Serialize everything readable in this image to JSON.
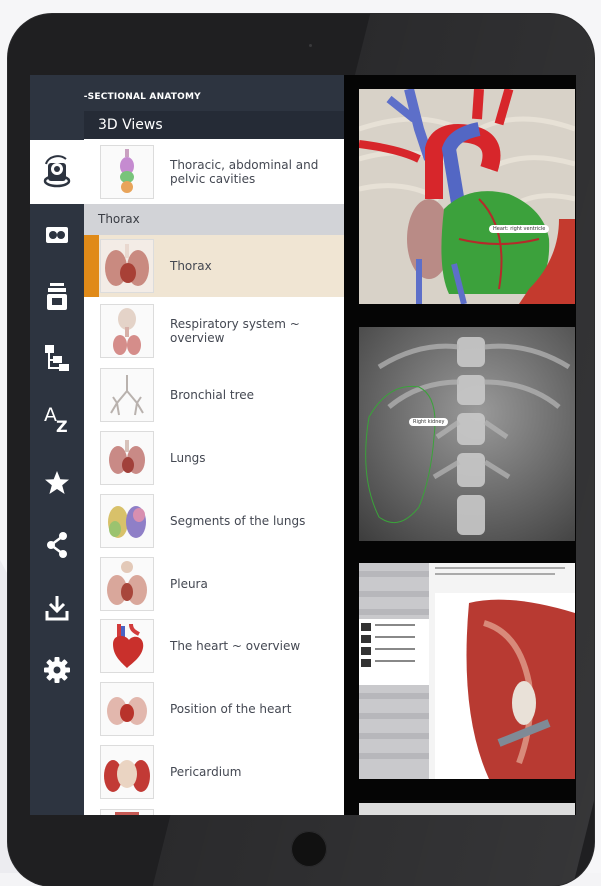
{
  "app": {
    "title": "CROSS-SECTIONAL ANATOMY"
  },
  "section": {
    "title": "3D Views"
  },
  "featured_item": {
    "label": "Thoracic, abdominal and pelvic cavities",
    "thumb_icon": "torso-organs-icon"
  },
  "category": {
    "title": "Thorax"
  },
  "rail_icons": [
    {
      "name": "3d-rotate-icon",
      "active": true
    },
    {
      "name": "cross-section-icon",
      "active": false
    },
    {
      "name": "layers-icon",
      "active": false
    },
    {
      "name": "hierarchy-icon",
      "active": false
    },
    {
      "name": "a-z-index-icon",
      "active": false
    },
    {
      "name": "star-icon",
      "active": false
    },
    {
      "name": "share-icon",
      "active": false
    },
    {
      "name": "download-icon",
      "active": false
    },
    {
      "name": "gear-icon",
      "active": false
    }
  ],
  "items": [
    {
      "label": "Thorax",
      "selected": true
    },
    {
      "label": "Respiratory system ~ overview",
      "selected": false
    },
    {
      "label": "Bronchial tree",
      "selected": false
    },
    {
      "label": "Lungs",
      "selected": false
    },
    {
      "label": "Segments of the lungs",
      "selected": false
    },
    {
      "label": "Pleura",
      "selected": false
    },
    {
      "label": "The heart ~ overview",
      "selected": false
    },
    {
      "label": "Position of the heart",
      "selected": false
    },
    {
      "label": "Pericardium",
      "selected": false
    }
  ],
  "previews": [
    {
      "name": "heart-3d-preview",
      "tag": "Heart: right ventricle"
    },
    {
      "name": "xray-preview",
      "tag": "Right kidney"
    },
    {
      "name": "document-preview",
      "tag": ""
    }
  ],
  "colors": {
    "rail": "#2d3440",
    "accent": "#e08a18",
    "selected_bg": "#f0e5d3",
    "category_bg": "#d2d3d7"
  }
}
